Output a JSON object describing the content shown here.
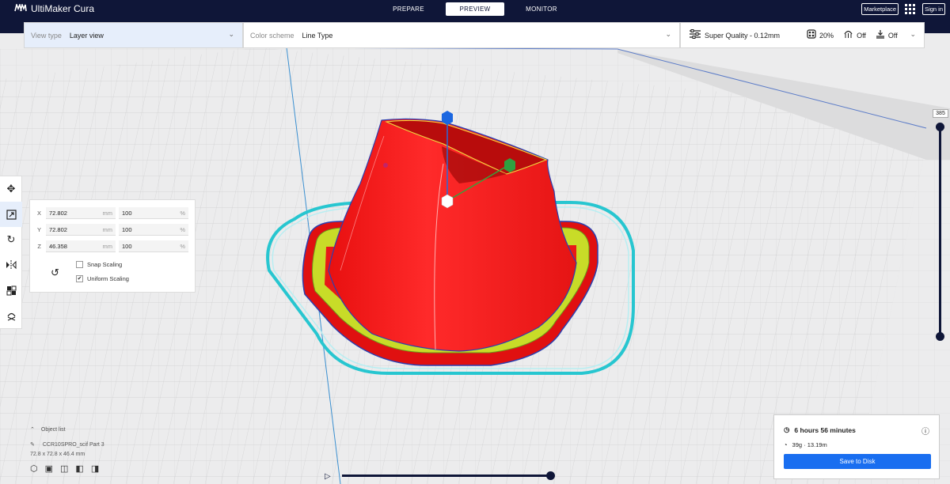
{
  "app": {
    "title": "UltiMaker Cura",
    "logo_icon": "ultimaker-logo-icon"
  },
  "stages": [
    {
      "label": "PREPARE",
      "active": false
    },
    {
      "label": "PREVIEW",
      "active": true
    },
    {
      "label": "MONITOR",
      "active": false
    }
  ],
  "top_right": {
    "marketplace": "Marketplace",
    "signin": "Sign in"
  },
  "view_type": {
    "label": "View type",
    "value": "Layer view"
  },
  "color_scheme": {
    "label": "Color scheme",
    "value": "Line Type"
  },
  "print_settings": {
    "profile": "Super Quality - 0.12mm",
    "infill": "20%",
    "support": "Off",
    "adhesion": "Off"
  },
  "scale": {
    "x": {
      "axis": "X",
      "mm": "72.802",
      "unit_mm": "mm",
      "pct": "100",
      "unit_pct": "%"
    },
    "y": {
      "axis": "Y",
      "mm": "72.802",
      "unit_mm": "mm",
      "pct": "100",
      "unit_pct": "%"
    },
    "z": {
      "axis": "Z",
      "mm": "46.358",
      "unit_mm": "mm",
      "pct": "100",
      "unit_pct": "%"
    },
    "snap_scaling": {
      "label": "Snap Scaling",
      "checked": false
    },
    "uniform_scaling": {
      "label": "Uniform Scaling",
      "checked": true,
      "mark": "✔"
    }
  },
  "layer_slider": {
    "value": "385",
    "fraction": 1.0
  },
  "object_list": {
    "title": "Object list",
    "name": "CCR10SPRO_scif Part 3",
    "dims": "72.8 x 72.8 x 46.4 mm"
  },
  "print_info": {
    "time": "6 hours 56 minutes",
    "material": "39g · 13.19m",
    "save_label": "Save to Disk"
  },
  "colors": {
    "accent": "#196ef0",
    "navy": "#0f1638",
    "wall": "#ff1a1a",
    "skirt": "#2fd3d3",
    "bottom": "#c8dc28"
  }
}
